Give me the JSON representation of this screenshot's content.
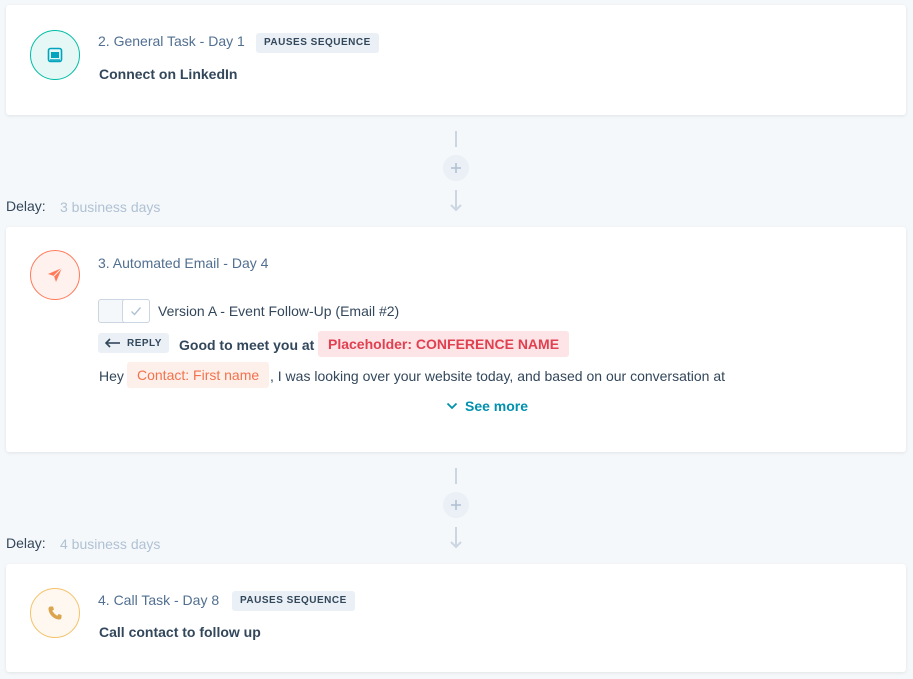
{
  "steps": [
    {
      "title": "2. General Task - Day 1",
      "badge": "PAUSES SEQUENCE",
      "task": "Connect on LinkedIn",
      "icon": "general-task-icon",
      "icon_color": "#00bda5"
    },
    {
      "title": "3. Automated Email - Day 4",
      "icon": "paper-plane-icon",
      "icon_color": "#ff7a59",
      "version": "Version A - Event Follow-Up (Email #2)",
      "reply_label": "REPLY",
      "subject": "Good to meet you at",
      "subject_token": "Placeholder: CONFERENCE NAME",
      "body_prefix": "Hey",
      "body_token": "Contact: First name",
      "body_suffix": ", I was looking over your website today, and based on our conversation at",
      "see_more": "See more",
      "see_more_icon": "chevron-down-icon"
    },
    {
      "title": "4. Call Task - Day 8",
      "badge": "PAUSES SEQUENCE",
      "task": "Call contact to follow up",
      "icon": "phone-icon",
      "icon_color": "#f5c26b"
    }
  ],
  "delays": [
    {
      "label": "Delay:",
      "value": "3 business days"
    },
    {
      "label": "Delay:",
      "value": "4 business days"
    }
  ],
  "connector_icons": [
    "plus-icon",
    "arrow-down-icon"
  ],
  "colors": {
    "background": "#f5f8fa",
    "link": "#0091ae",
    "token_placeholder_bg": "#fde4e6",
    "token_placeholder_text": "#e04050",
    "token_contact_bg": "#fdefe9",
    "token_contact_text": "#f2724e"
  }
}
